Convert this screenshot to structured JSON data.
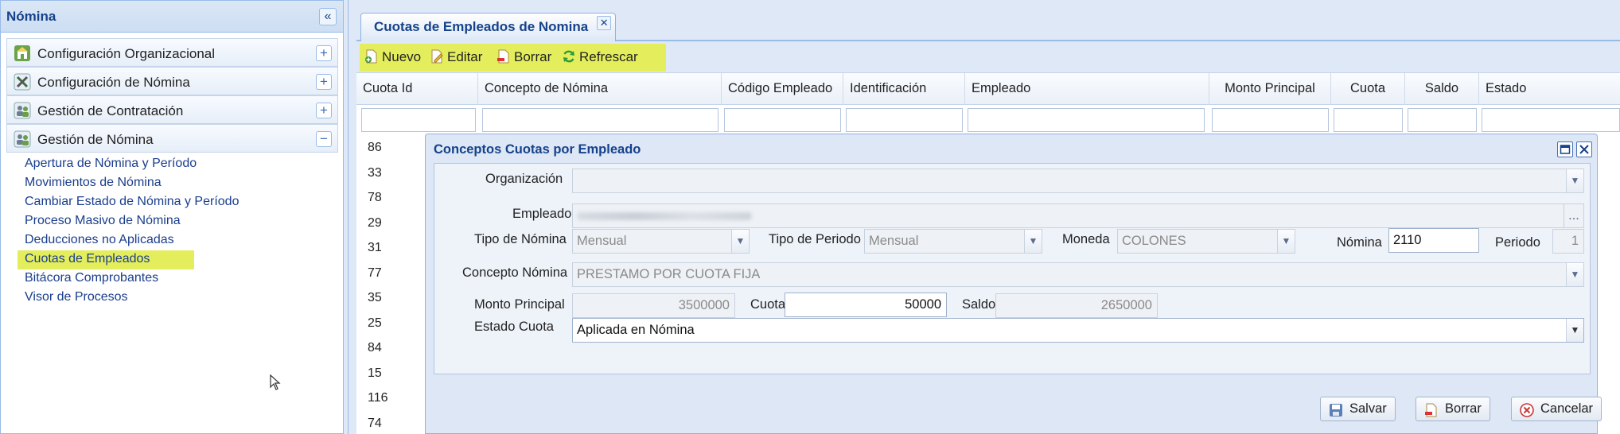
{
  "left_panel": {
    "title": "Nómina",
    "collapse_glyph": "«",
    "sections": [
      {
        "label": "Configuración Organizacional",
        "icon": "building-icon",
        "toggle": "+"
      },
      {
        "label": "Configuración de Nómina",
        "icon": "tools-icon",
        "toggle": "+"
      },
      {
        "label": "Gestión de Contratación",
        "icon": "people-icon",
        "toggle": "+"
      },
      {
        "label": "Gestión de Nómina",
        "icon": "people-icon",
        "toggle": "−"
      }
    ],
    "subitems": [
      "Apertura de Nómina y Período",
      "Movimientos de Nómina",
      "Cambiar Estado de Nómina y Período",
      "Proceso Masivo de Nómina",
      "Deducciones no Aplicadas",
      "Cuotas de Empleados",
      "Bitácora Comprobantes",
      "Visor de Procesos"
    ],
    "active_subitem": "Cuotas de Empleados"
  },
  "tab": {
    "label": "Cuotas de Empleados de Nomina",
    "close_glyph": "✕"
  },
  "toolbar": {
    "new": "Nuevo",
    "edit": "Editar",
    "delete": "Borrar",
    "refresh": "Refrescar"
  },
  "grid": {
    "columns": [
      "Cuota Id",
      "Concepto de Nómina",
      "Código Empleado",
      "Identificación",
      "Empleado",
      "Monto Principal",
      "Cuota",
      "Saldo",
      "Estado"
    ],
    "row_ids": [
      "86",
      "33",
      "78",
      "29",
      "31",
      "77",
      "35",
      "25",
      "84",
      "15",
      "116",
      "74"
    ]
  },
  "dialog": {
    "title": "Conceptos Cuotas por Empleado",
    "labels": {
      "organizacion": "Organización",
      "empleado": "Empleado",
      "tipo_nomina": "Tipo de Nómina",
      "tipo_periodo": "Tipo de Periodo",
      "moneda": "Moneda",
      "nomina": "Nómina",
      "periodo": "Periodo",
      "concepto": "Concepto Nómina",
      "monto_principal": "Monto Principal",
      "cuota": "Cuota",
      "saldo": "Saldo",
      "estado_cuota": "Estado Cuota"
    },
    "values": {
      "organizacion": "",
      "tipo_nomina": "Mensual",
      "tipo_periodo": "Mensual",
      "moneda": "COLONES",
      "nomina": "2110",
      "periodo": "1",
      "concepto": "PRESTAMO POR CUOTA FIJA",
      "monto_principal": "3500000",
      "cuota": "50000",
      "saldo": "2650000",
      "estado_cuota": "Aplicada en Nómina"
    },
    "lookup_glyph": "...",
    "buttons": {
      "save": "Salvar",
      "delete": "Borrar",
      "cancel": "Cancelar"
    }
  },
  "colors": {
    "highlight": "#e4ee5c",
    "header_text": "#15428b",
    "link_text": "#1a3e8c"
  }
}
